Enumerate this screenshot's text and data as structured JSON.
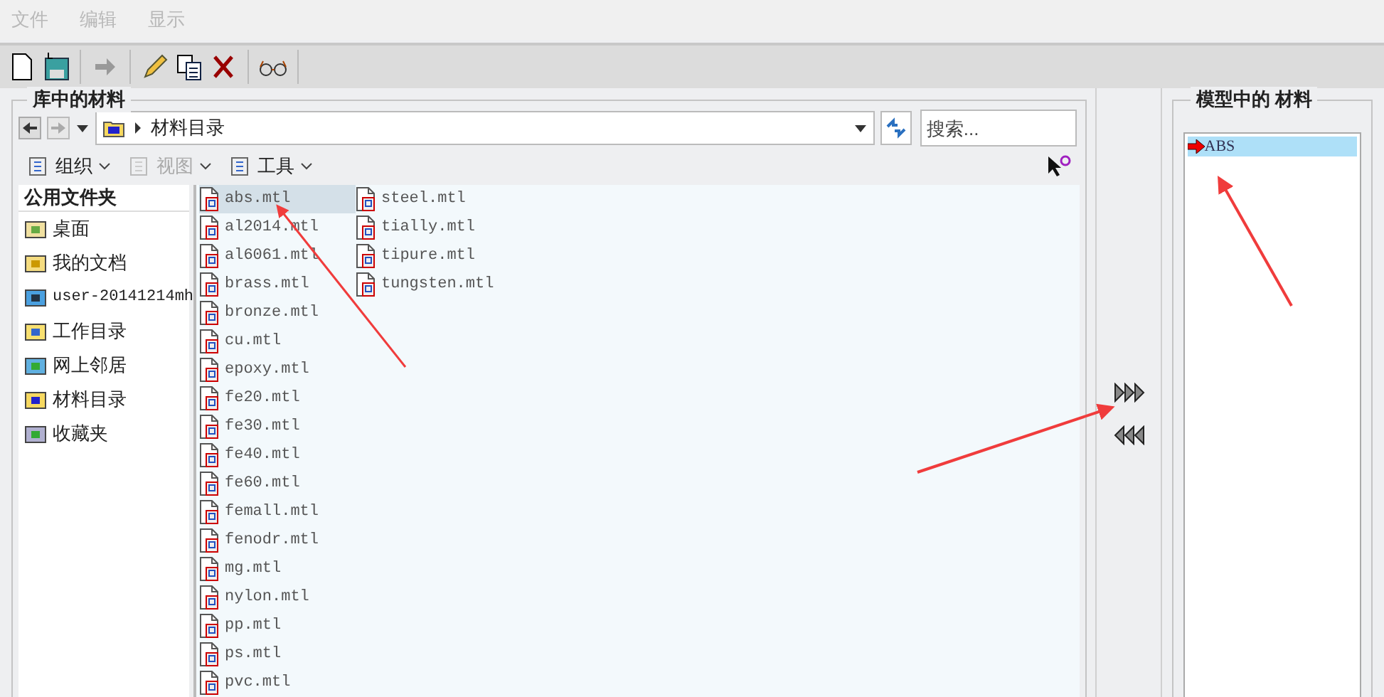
{
  "menu": [
    {
      "label": "文件",
      "disabled": true
    },
    {
      "label": "编辑",
      "disabled": true
    },
    {
      "label": "显示",
      "disabled": true
    }
  ],
  "library": {
    "title": "库中的材料",
    "breadcrumb": "材料目录",
    "search": {
      "placeholder": "搜索..."
    },
    "commands": [
      {
        "label": "组织",
        "disabled": false
      },
      {
        "label": "视图",
        "disabled": true
      },
      {
        "label": "工具",
        "disabled": false
      }
    ],
    "sidebar": {
      "heading": "公用文件夹",
      "items": [
        {
          "label": "桌面",
          "kind": "desktop",
          "mono": false
        },
        {
          "label": "我的文档",
          "kind": "documents",
          "mono": false
        },
        {
          "label": "user-20141214mh",
          "kind": "computer",
          "mono": true
        },
        {
          "label": "工作目录",
          "kind": "workdir",
          "mono": false
        },
        {
          "label": "网上邻居",
          "kind": "network",
          "mono": false
        },
        {
          "label": "材料目录",
          "kind": "folder",
          "mono": false
        },
        {
          "label": "收藏夹",
          "kind": "favorites",
          "mono": false
        }
      ]
    },
    "files": [
      {
        "name": "abs.mtl",
        "selected": true
      },
      {
        "name": "al2014.mtl",
        "selected": false
      },
      {
        "name": "al6061.mtl",
        "selected": false
      },
      {
        "name": "brass.mtl",
        "selected": false
      },
      {
        "name": "bronze.mtl",
        "selected": false
      },
      {
        "name": "cu.mtl",
        "selected": false
      },
      {
        "name": "epoxy.mtl",
        "selected": false
      },
      {
        "name": "fe20.mtl",
        "selected": false
      },
      {
        "name": "fe30.mtl",
        "selected": false
      },
      {
        "name": "fe40.mtl",
        "selected": false
      },
      {
        "name": "fe60.mtl",
        "selected": false
      },
      {
        "name": "femall.mtl",
        "selected": false
      },
      {
        "name": "fenodr.mtl",
        "selected": false
      },
      {
        "name": "mg.mtl",
        "selected": false
      },
      {
        "name": "nylon.mtl",
        "selected": false
      },
      {
        "name": "pp.mtl",
        "selected": false
      },
      {
        "name": "ps.mtl",
        "selected": false
      },
      {
        "name": "pvc.mtl",
        "selected": false
      },
      {
        "name": "steel.mtl",
        "selected": false
      },
      {
        "name": "tially.mtl",
        "selected": false
      },
      {
        "name": "tipure.mtl",
        "selected": false
      },
      {
        "name": "tungsten.mtl",
        "selected": false
      }
    ]
  },
  "model": {
    "title": "模型中的 材料",
    "items": [
      {
        "name": "ABS",
        "selected": true
      }
    ]
  }
}
